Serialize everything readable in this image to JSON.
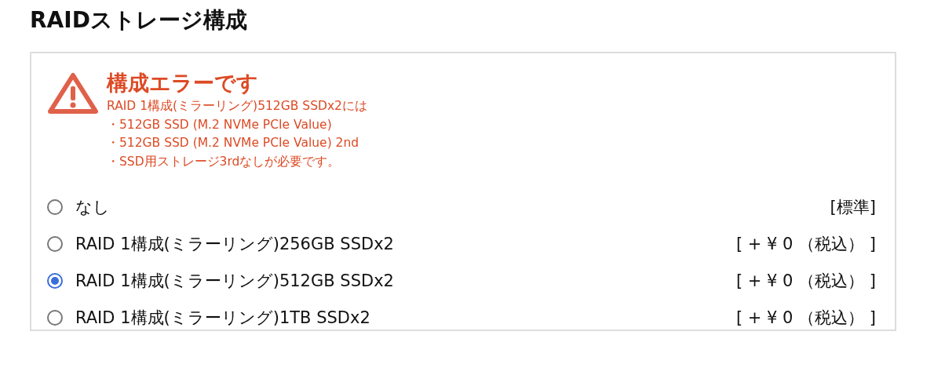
{
  "title": "RAIDストレージ構成",
  "error": {
    "heading": "構成エラーです",
    "lines": [
      "RAID 1構成(ミラーリング)512GB SSDx2には",
      "・512GB SSD (M.2 NVMe PCIe Value)",
      "・512GB SSD (M.2 NVMe PCIe Value) 2nd",
      "・SSD用ストレージ3rdなしが必要です。"
    ]
  },
  "options": [
    {
      "label": "なし",
      "price": "[標準]",
      "selected": false
    },
    {
      "label": "RAID 1構成(ミラーリング)256GB SSDx2",
      "price": "[ + ¥ 0 （税込） ]",
      "selected": false
    },
    {
      "label": "RAID 1構成(ミラーリング)512GB SSDx2",
      "price": "[ + ¥ 0 （税込） ]",
      "selected": true
    },
    {
      "label": "RAID 1構成(ミラーリング)1TB SSDx2",
      "price": "[ + ¥ 0 （税込） ]",
      "selected": false
    }
  ]
}
